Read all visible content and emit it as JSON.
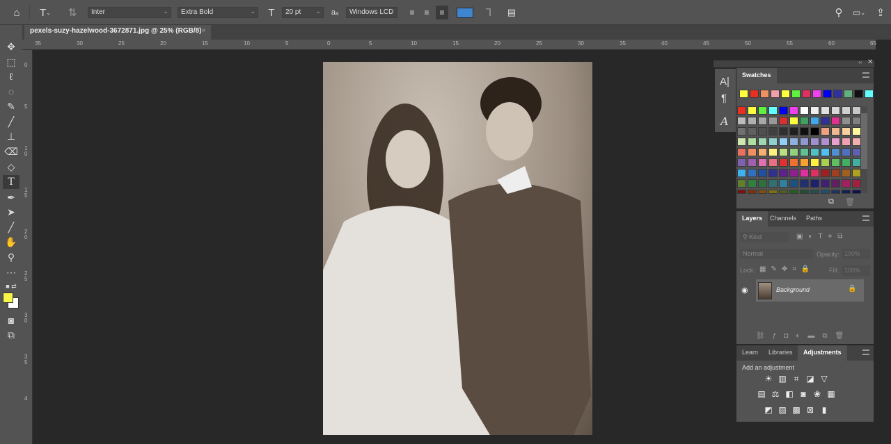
{
  "options_bar": {
    "font_family": "Inter",
    "font_style": "Extra Bold",
    "font_size": "20 pt",
    "antialias_label": "aₐ",
    "antialias": "Windows LCD",
    "color_swatch": "#3f86d0"
  },
  "document_tab": {
    "title": "pexels-suzy-hazelwood-3672871.jpg @ 25% (RGB/8)",
    "close": "×"
  },
  "rulers": {
    "horizontal": [
      "35",
      "30",
      "25",
      "20",
      "15",
      "10",
      "5",
      "0",
      "5",
      "10",
      "15",
      "20",
      "25",
      "30",
      "35",
      "40",
      "45",
      "50",
      "55",
      "60",
      "65"
    ],
    "vertical": [
      "0",
      "5",
      "10",
      "15",
      "20",
      "25",
      "30",
      "35",
      "4"
    ]
  },
  "tools": [
    "move",
    "marquee",
    "lasso",
    "quick-selection",
    "eyedropper",
    "brush",
    "clone-stamp",
    "eraser",
    "paint-bucket",
    "type",
    "pen",
    "path-selection",
    "line",
    "hand",
    "zoom",
    "more"
  ],
  "colors": {
    "foreground": "#f7f44a",
    "background": "#ffffff"
  },
  "swatches": {
    "title": "Swatches",
    "recent": [
      "#ffff40",
      "#e83020",
      "#f09060",
      "#f0a0a8",
      "#ffff40",
      "#60f040",
      "#e03060",
      "#f040f0",
      "#0000f0",
      "#3030a0",
      "#60b080",
      "#101010",
      "#60ffff"
    ],
    "grid": [
      "#e83020",
      "#ffff40",
      "#60f040",
      "#60ffff",
      "#0000f0",
      "#f040f0",
      "#ffffff",
      "#eeeeee",
      "#e0e0e0",
      "#d8d8d8",
      "#d0d0d0",
      "#c8c8c8",
      "#bbbbbb",
      "#b0b0b0",
      "#a8a8a8",
      "#999999",
      "#d83030",
      "#ffff40",
      "#40a060",
      "#40a8e8",
      "#303098",
      "#e03090",
      "#909090",
      "#808080",
      "#707070",
      "#606060",
      "#505050",
      "#404040",
      "#303030",
      "#202020",
      "#101010",
      "#000000",
      "#f0a080",
      "#f0b890",
      "#f8d0a0",
      "#fff8a0",
      "#d0e8b0",
      "#b0e0a0",
      "#a0d8b0",
      "#90d0d0",
      "#90d0f8",
      "#90b0e0",
      "#9098d0",
      "#a090d0",
      "#b090d0",
      "#e8a0d0",
      "#f0a0b0",
      "#f0b0b0",
      "#e87060",
      "#f09060",
      "#f8b070",
      "#fff080",
      "#b8e080",
      "#90d080",
      "#60c090",
      "#50c0c0",
      "#50c0f0",
      "#5090d0",
      "#5070c0",
      "#6060b0",
      "#8060b0",
      "#a060b0",
      "#e070b0",
      "#e87080",
      "#e03030",
      "#f07030",
      "#f8a030",
      "#fff040",
      "#a8d050",
      "#60c060",
      "#40b060",
      "#40b0a0",
      "#40b0f0",
      "#3070c0",
      "#2050a0",
      "#303090",
      "#602090",
      "#902090",
      "#e030a0",
      "#e03060",
      "#a02020",
      "#a04020",
      "#a06020",
      "#b0a020",
      "#608030",
      "#308040",
      "#307040",
      "#307070",
      "#3080a0",
      "#205080",
      "#203070",
      "#202070",
      "#402070",
      "#602060",
      "#a02060",
      "#a02040",
      "#801010",
      "#803010",
      "#805010",
      "#807010",
      "#506020",
      "#206020",
      "#205030",
      "#205050",
      "#205070",
      "#203060",
      "#102050",
      "#101050"
    ]
  },
  "layers": {
    "tabs": [
      "Layers",
      "Channels",
      "Paths"
    ],
    "filter_placeholder": "Kind",
    "blend_mode": "Normal",
    "opacity_label": "Opacity:",
    "opacity": "100%",
    "lock_label": "Lock:",
    "fill_label": "Fill:",
    "fill": "100%",
    "items": [
      {
        "name": "Background",
        "visible": true,
        "locked": true
      }
    ]
  },
  "adjustments": {
    "tabs": [
      "Learn",
      "Libraries",
      "Adjustments"
    ],
    "hint": "Add an adjustment"
  }
}
